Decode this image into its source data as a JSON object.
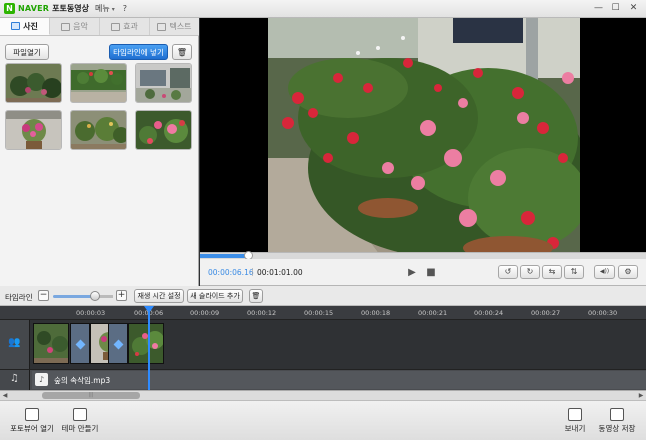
{
  "titlebar": {
    "logo_letter": "N",
    "brand": "NAVER",
    "app_title": "포토동영상",
    "menu_label": "메뉴",
    "menu_caret": "▾",
    "help_label": "?",
    "minimize": "—",
    "maximize": "☐",
    "close": "✕"
  },
  "tabs": [
    {
      "label": "사진",
      "active": true
    },
    {
      "label": "음악",
      "active": false
    },
    {
      "label": "효과",
      "active": false
    },
    {
      "label": "텍스트",
      "active": false
    }
  ],
  "photo_panel": {
    "open_file_label": "파일열기",
    "add_to_timeline_label": "타임라인에 넣기",
    "delete_icon": "🗑",
    "thumbnails": [
      "garden-1",
      "garden-2",
      "garden-3",
      "garden-4",
      "garden-5",
      "garden-6"
    ]
  },
  "preview": {
    "current_time": "00:00:06.16",
    "time_separator": "|",
    "total_time": "00:01:01.00",
    "progress": 0.11,
    "play_icon": "▶",
    "stop_icon": "■",
    "rotate_left_icon": "↺",
    "rotate_right_icon": "↻",
    "flip_h_icon": "⇆",
    "flip_v_icon": "⇅",
    "volume_icon": "◀))",
    "settings_icon": "⚙"
  },
  "timeline_bar": {
    "label": "타임라인",
    "zoom_out": "−",
    "zoom_in": "+",
    "zoom_level": 0.7,
    "play_time_setting": "재생 시간 설정",
    "add_slide": "새 슬라이드 추가",
    "delete_icon": "🗑"
  },
  "ruler_ticks": [
    "00:00:03",
    "00:00:06",
    "00:00:09",
    "00:00:12",
    "00:00:15",
    "00:00:18",
    "00:00:21",
    "00:00:24",
    "00:00:27",
    "00:00:30"
  ],
  "tracks": {
    "photo_track_icon": "👥",
    "audio_track_icon": "♫",
    "audio_file_icon": "♪",
    "audio_name": "숲의 속삭임.mp3"
  },
  "scrollbar": {
    "left_arrow": "◀",
    "right_arrow": "▶",
    "grip": "|||"
  },
  "bottom": {
    "photo_viewer": "포토뷰어 열기",
    "make_theme": "테마 만들기",
    "export": "보내기",
    "save_video": "동영상 저장"
  },
  "colors": {
    "accent": "#2f7ed8",
    "naver_green": "#1ea400",
    "playhead": "#2e8bff"
  }
}
